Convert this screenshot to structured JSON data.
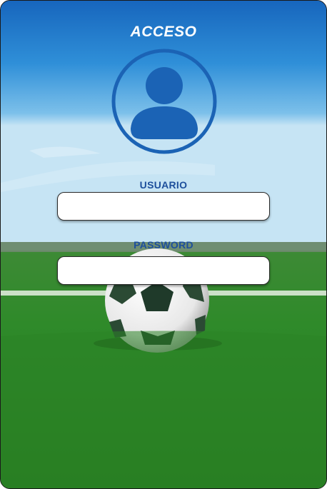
{
  "screen": {
    "title": "ACCESO"
  },
  "form": {
    "username": {
      "label": "USUARIO",
      "value": "",
      "placeholder": ""
    },
    "password": {
      "label": "PASSWORD",
      "value": "",
      "placeholder": ""
    }
  },
  "icons": {
    "avatar": "user-avatar-icon"
  },
  "colors": {
    "title": "#ffffff",
    "label": "#1d4f9c",
    "avatar": "#1b63b5"
  }
}
